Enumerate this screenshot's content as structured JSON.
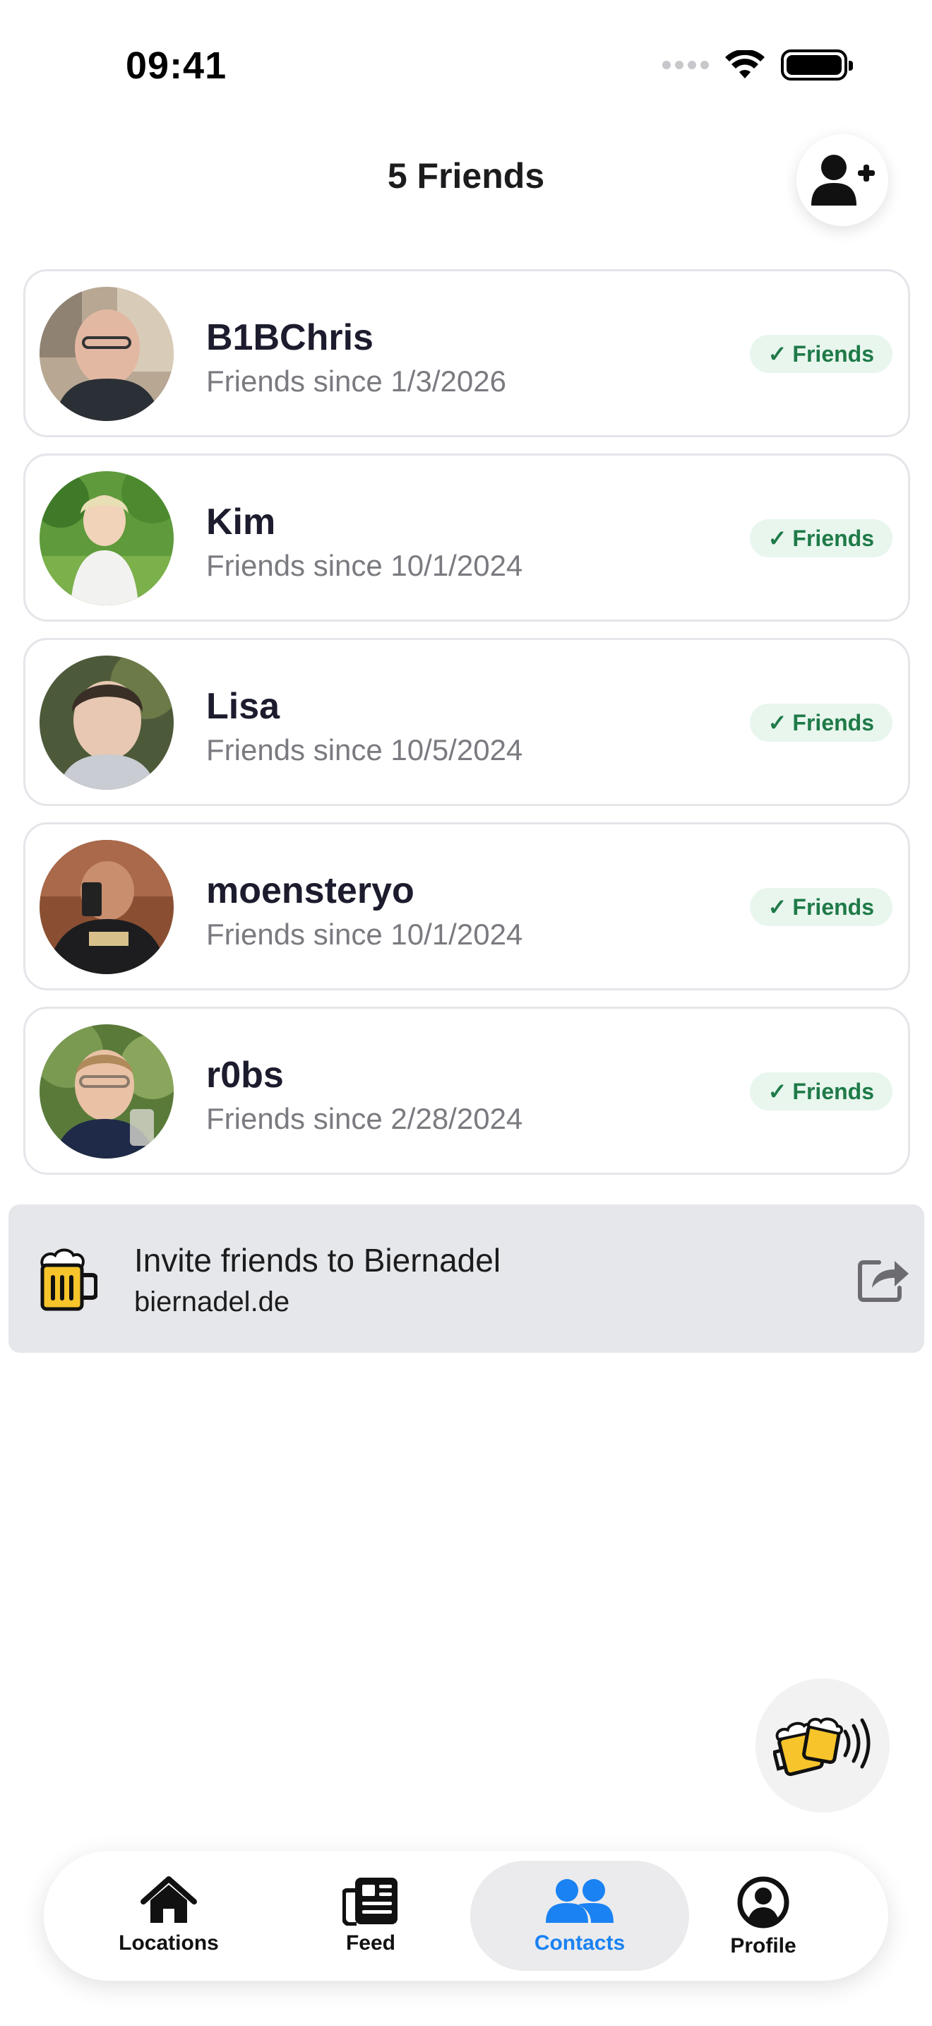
{
  "status_bar": {
    "time": "09:41"
  },
  "header": {
    "title": "5 Friends",
    "add_friend_icon": "user-plus-icon"
  },
  "friends": [
    {
      "name": "B1BChris",
      "since": "Friends since 1/3/2026",
      "badge": "Friends"
    },
    {
      "name": "Kim",
      "since": "Friends since 10/1/2024",
      "badge": "Friends"
    },
    {
      "name": "Lisa",
      "since": "Friends since 10/5/2024",
      "badge": "Friends"
    },
    {
      "name": "moensteryo",
      "since": "Friends since 10/1/2024",
      "badge": "Friends"
    },
    {
      "name": "r0bs",
      "since": "Friends since 2/28/2024",
      "badge": "Friends"
    }
  ],
  "badge_check": "✓",
  "invite": {
    "title": "Invite friends to Biernadel",
    "url": "biernadel.de",
    "icon": "beer-mug-icon",
    "action_icon": "share-icon"
  },
  "fab": {
    "icon": "beer-cheers-icon"
  },
  "tabs": [
    {
      "label": "Locations",
      "icon": "house-icon",
      "active": false
    },
    {
      "label": "Feed",
      "icon": "newspaper-icon",
      "active": false
    },
    {
      "label": "Contacts",
      "icon": "users-icon",
      "active": true
    },
    {
      "label": "Profile",
      "icon": "user-circle-icon",
      "active": false
    }
  ],
  "colors": {
    "accent": "#1a82f2",
    "badge_bg": "#e8f6ee",
    "badge_text": "#1f7a48",
    "card_border": "#e5e5ea",
    "invite_bg": "#e6e7ea",
    "beer_yellow": "#f7c52b"
  }
}
